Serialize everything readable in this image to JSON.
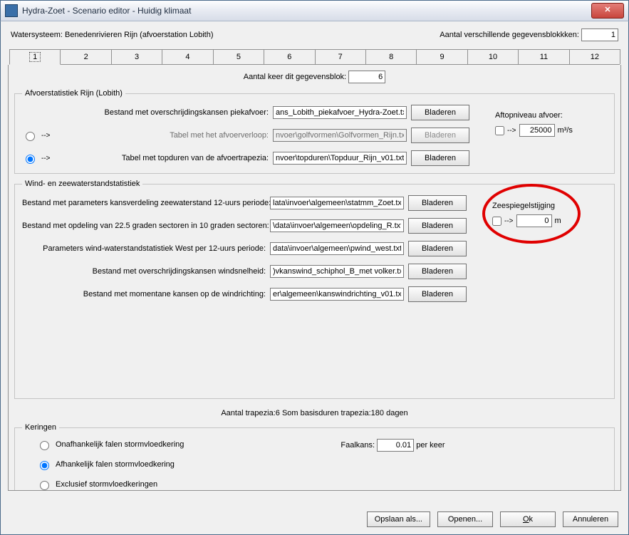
{
  "title": "Hydra-Zoet - Scenario editor - Huidig klimaat",
  "close_glyph": "✕",
  "row1": {
    "watersystem_label": "Watersysteem:",
    "watersystem_value": "Benedenrivieren Rijn (afvoerstation Lobith)",
    "blocks_label": "Aantal verschillende gegevensblokkken:",
    "blocks_value": "1"
  },
  "tabs": [
    "1",
    "2",
    "3",
    "4",
    "5",
    "6",
    "7",
    "8",
    "9",
    "10",
    "11",
    "12"
  ],
  "tabpage": {
    "repeat_label": "Aantal keer dit gegevensblok:",
    "repeat_value": "6"
  },
  "afvoer": {
    "legend": "Afvoerstatistiek Rijn (Lobith)",
    "arrow": "-->",
    "row1_label": "Bestand met overschrijdingskansen piekafvoer:",
    "row1_file": "ans_Lobith_piekafvoer_Hydra-Zoet.txt",
    "row2_label": "Tabel met het afvoerverloop:",
    "row2_file": "nvoer\\golfvormen\\Golfvormen_Rijn.txt",
    "row3_label": "Tabel met topduren van de afvoertrapezia:",
    "row3_file": "nvoer\\topduren\\Topduur_Rijn_v01.txt",
    "browse": "Bladeren",
    "aftop_title": "Aftopniveau afvoer:",
    "aftop_value": "25000",
    "aftop_unit": "m³/s"
  },
  "wind": {
    "legend": "Wind- en zeewaterstandstatistiek",
    "r1_label": "Bestand met parameters kansverdeling zeewaterstand 12-uurs periode:",
    "r1_file": "lata\\invoer\\algemeen\\statmm_Zoet.txt",
    "r2_label": "Bestand met opdeling van 22.5 graden sectoren in 10 graden sectoren:",
    "r2_file": "\\data\\invoer\\algemeen\\opdeling_R.txt",
    "r3_label": "Parameters wind-waterstandstatistiek West per 12-uurs periode:",
    "r3_file": "data\\invoer\\algemeen\\pwind_west.txt",
    "r4_label": "Bestand met overschrijdingskansen windsnelheid:",
    "r4_file": ")vkanswind_schiphol_B_met volker.txt",
    "r5_label": "Bestand met momentane kansen op de windrichting:",
    "r5_file": "er\\algemeen\\kanswindrichting_v01.txt",
    "browse": "Bladeren",
    "zs_title": "Zeespiegelstijging",
    "zs_arrow": "-->",
    "zs_value": "0",
    "zs_unit": "m"
  },
  "detail_line": "Aantal trapezia:6  Som basisduren trapezia:180 dagen",
  "kering": {
    "legend": "Keringen",
    "r1": "Onafhankelijk falen stormvloedkering",
    "r2": "Afhankelijk falen stormvloedkering",
    "r3": "Exclusief stormvloedkeringen",
    "fk_label": "Faalkans:",
    "fk_value": "0.01",
    "fk_unit": "per keer"
  },
  "buttons": {
    "saveas": "Opslaan als...",
    "open": "Openen...",
    "ok": "Ok",
    "cancel": "Annuleren"
  }
}
